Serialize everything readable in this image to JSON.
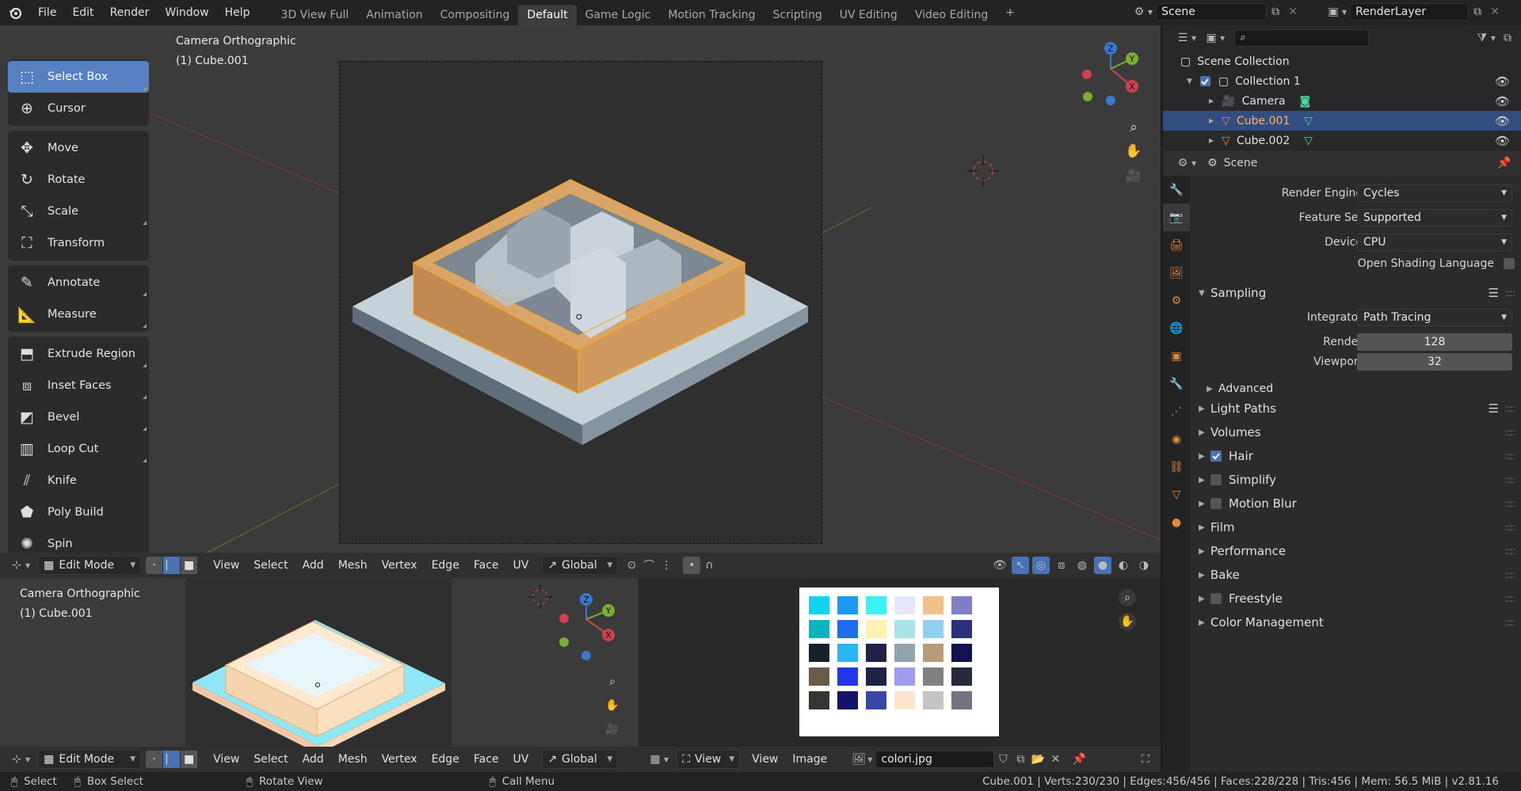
{
  "topbar": {
    "menus": [
      "File",
      "Edit",
      "Render",
      "Window",
      "Help"
    ],
    "workspaces": [
      "3D View Full",
      "Animation",
      "Compositing",
      "Default",
      "Game Logic",
      "Motion Tracking",
      "Scripting",
      "UV Editing",
      "Video Editing"
    ],
    "active_workspace": "Default",
    "add_tab": "+",
    "scene_name": "Scene",
    "view_layer": "RenderLayer"
  },
  "viewport": {
    "camera_label": "Camera Orthographic",
    "object_label": "(1) Cube.001",
    "gizmo": {
      "x": "X",
      "y": "Y",
      "z": "Z"
    }
  },
  "toolbar": {
    "groups": [
      [
        {
          "label": "Select Box",
          "icon": "select-box-icon",
          "active": true
        },
        {
          "label": "Cursor",
          "icon": "cursor-icon"
        }
      ],
      [
        {
          "label": "Move",
          "icon": "move-icon"
        },
        {
          "label": "Rotate",
          "icon": "rotate-icon"
        },
        {
          "label": "Scale",
          "icon": "scale-icon"
        },
        {
          "label": "Transform",
          "icon": "transform-icon"
        }
      ],
      [
        {
          "label": "Annotate",
          "icon": "annotate-icon"
        },
        {
          "label": "Measure",
          "icon": "measure-icon"
        }
      ],
      [
        {
          "label": "Extrude Region",
          "icon": "extrude-region-icon"
        },
        {
          "label": "Inset Faces",
          "icon": "inset-faces-icon"
        },
        {
          "label": "Bevel",
          "icon": "bevel-icon"
        },
        {
          "label": "Loop Cut",
          "icon": "loop-cut-icon"
        },
        {
          "label": "Knife",
          "icon": "knife-icon"
        },
        {
          "label": "Poly Build",
          "icon": "poly-build-icon"
        },
        {
          "label": "Spin",
          "icon": "spin-icon"
        }
      ]
    ]
  },
  "header3d": {
    "mode": "Edit Mode",
    "menus": [
      "View",
      "Select",
      "Add",
      "Mesh",
      "Vertex",
      "Edge",
      "Face",
      "UV"
    ],
    "orientation": "Global"
  },
  "bottom_viewport": {
    "camera_label": "Camera Orthographic",
    "object_label": "(1) Cube.001"
  },
  "image_editor": {
    "menus": [
      "View",
      "View",
      "Image"
    ],
    "image_name": "colori.jpg",
    "palette": [
      [
        "#11d3ef",
        "#1a9af0",
        "#3df0f5",
        "#e6e6fa",
        "#f2c08a",
        "#7f7fc6"
      ],
      [
        "#0ab4c0",
        "#1e6cf0",
        "#fdf2b0",
        "#a9e4ea",
        "#8fd0f0",
        "#2b2f7c"
      ],
      [
        "#14222b",
        "#2bb6f2",
        "#202048",
        "#95a4ac",
        "#b89b78",
        "#14124e"
      ],
      [
        "#6a5a48",
        "#2236ee",
        "#1e2248",
        "#9f9cf4",
        "#808080",
        "#262a3c"
      ],
      [
        "#363630",
        "#121266",
        "#3846a8",
        "#fde4cc",
        "#c4c4c4",
        "#727282"
      ]
    ]
  },
  "outliner": {
    "root": "Scene Collection",
    "collection": "Collection 1",
    "items": [
      {
        "name": "Camera",
        "selected": false
      },
      {
        "name": "Cube.001",
        "selected": true
      },
      {
        "name": "Cube.002",
        "selected": false
      }
    ]
  },
  "properties": {
    "context": "Scene",
    "render_engine_label": "Render Engine",
    "render_engine": "Cycles",
    "feature_set_label": "Feature Set",
    "feature_set": "Supported",
    "device_label": "Device",
    "device": "CPU",
    "osl_label": "Open Shading Language",
    "sampling_label": "Sampling",
    "integrator_label": "Integrator",
    "integrator": "Path Tracing",
    "render_label": "Render",
    "render_samples": "128",
    "viewport_label": "Viewport",
    "viewport_samples": "32",
    "advanced_label": "Advanced",
    "panels": [
      {
        "label": "Light Paths",
        "checkbox": null,
        "list": true
      },
      {
        "label": "Volumes",
        "checkbox": null
      },
      {
        "label": "Hair",
        "checkbox": true
      },
      {
        "label": "Simplify",
        "checkbox": false
      },
      {
        "label": "Motion Blur",
        "checkbox": false
      },
      {
        "label": "Film",
        "checkbox": null
      },
      {
        "label": "Performance",
        "checkbox": null
      },
      {
        "label": "Bake",
        "checkbox": null
      },
      {
        "label": "Freestyle",
        "checkbox": false
      },
      {
        "label": "Color Management",
        "checkbox": null
      }
    ]
  },
  "statusbar": {
    "select": "Select",
    "box_select": "Box Select",
    "rotate_view": "Rotate View",
    "call_menu": "Call Menu",
    "stats": "Cube.001 | Verts:230/230 | Edges:456/456 | Faces:228/228 | Tris:456 | Mem: 56.5 MiB | v2.81.16"
  },
  "colors": {
    "accent": "#4772b3",
    "selected_row": "#334d80",
    "active_tool": "#5680c2",
    "edit_outline": "#f5a623"
  }
}
